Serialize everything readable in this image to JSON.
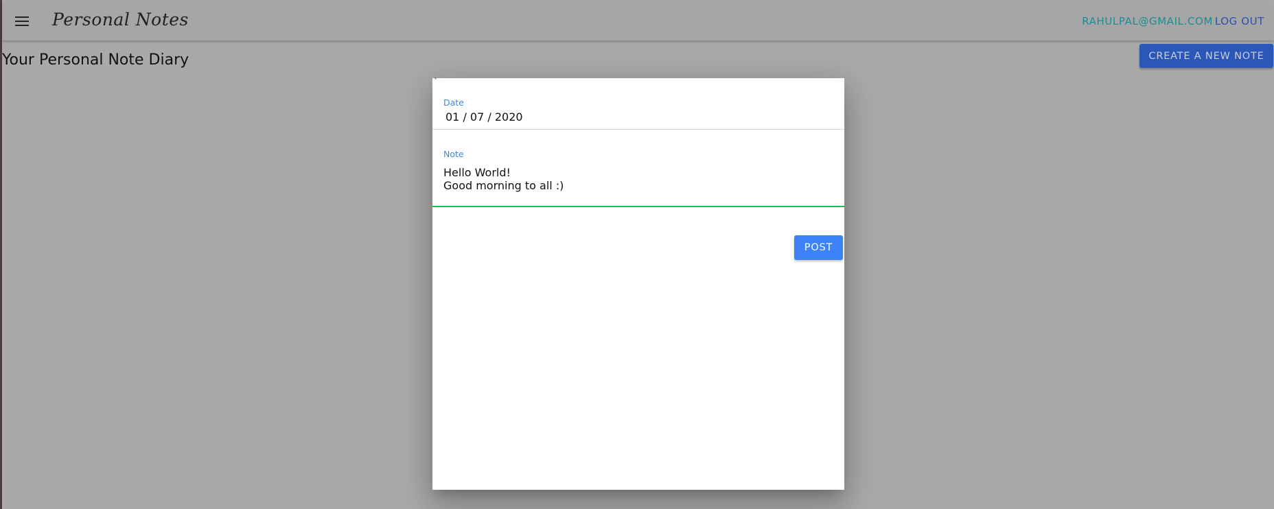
{
  "app": {
    "brand": "Personal Notes",
    "menu_icon": "hamburger-menu-icon"
  },
  "nav": {
    "email": "RAHULPAL@GMAIL.COM",
    "logout": "LOG OUT"
  },
  "page": {
    "title": "Your Personal Note Diary",
    "create_button": "CREATE A NEW NOTE"
  },
  "dialog": {
    "tick": "`",
    "date_label": "Date",
    "date_value": "01 / 07 / 2020",
    "note_label": "Note",
    "note_value": "Hello World!\nGood morning to all :)",
    "post_button": "POST"
  },
  "colors": {
    "overlay": "#a9a9a9",
    "primary_button": "#3d82f7",
    "label_blue": "#3b86e8",
    "focus_underline": "#1fbf56",
    "email_link": "#1c8d94"
  }
}
